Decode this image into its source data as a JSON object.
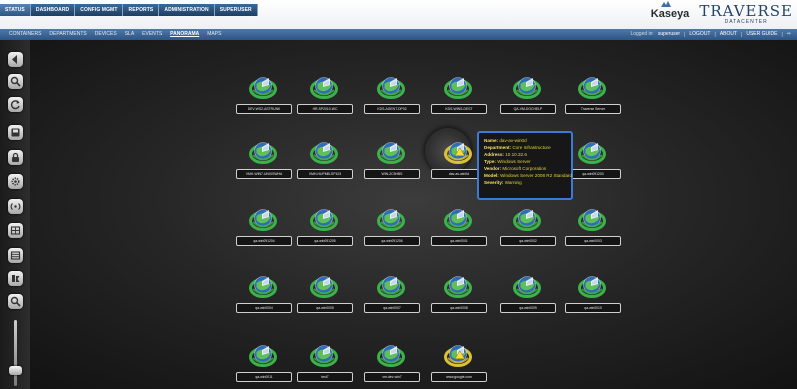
{
  "header": {
    "tabs": [
      {
        "label": "STATUS",
        "active": true
      },
      {
        "label": "DASHBOARD",
        "active": false
      },
      {
        "label": "CONFIG MGMT",
        "active": false
      },
      {
        "label": "REPORTS",
        "active": false
      },
      {
        "label": "ADMINISTRATION",
        "active": false
      },
      {
        "label": "SUPERUSER",
        "active": false
      }
    ],
    "logo_kaseya": "Kaseya",
    "logo_traverse": "TRAVERSE",
    "logo_traverse_sub": "DATACENTER"
  },
  "subnav": {
    "items": [
      "CONTAINERS",
      "DEPARTMENTS",
      "DEVICES",
      "SLA",
      "EVENTS",
      "PANORAMA",
      "MAPS"
    ],
    "current": "PANORAMA",
    "logged_in_label": "Logged in:",
    "username": "superuser",
    "logout": "LOGOUT",
    "about": "ABOUT",
    "user_guide": "USER GUIDE"
  },
  "toolbar": {
    "icons": [
      "back-icon",
      "search-icon",
      "refresh-icon",
      "save-icon",
      "lock-icon",
      "settings-icon",
      "radio-icon",
      "layout-icon",
      "grid-icon",
      "filter-icon",
      "zoom-icon"
    ]
  },
  "devices": [
    {
      "name": "DEV-WS2-ASTRUNK",
      "status": "ok"
    },
    {
      "name": "HR-SP2010-WC",
      "status": "ok"
    },
    {
      "name": "KDS-AGENT-DP02",
      "status": "ok"
    },
    {
      "name": "KDS-WINS-DEST",
      "status": "ok"
    },
    {
      "name": "QA-VM-DOCHELP",
      "status": "ok"
    },
    {
      "name": "Traverse Server",
      "status": "ok"
    },
    {
      "name": "VMH-WIN7-UNIXSWHA",
      "status": "ok"
    },
    {
      "name": "VMH-HUPMB-SP103",
      "status": "ok"
    },
    {
      "name": "WIN-2C5HBS",
      "status": "ok"
    },
    {
      "name": "dav-av-win0d",
      "status": "warning"
    },
    {
      "name": "qa-win0010",
      "status": "ok"
    },
    {
      "name": "qa-win091203",
      "status": "ok"
    },
    {
      "name": "qa-win091204",
      "status": "ok"
    },
    {
      "name": "qa-win091205",
      "status": "ok"
    },
    {
      "name": "qa-win091206",
      "status": "ok"
    },
    {
      "name": "qa-win0001",
      "status": "ok"
    },
    {
      "name": "qa-win0002",
      "status": "ok"
    },
    {
      "name": "qa-win0003",
      "status": "ok"
    },
    {
      "name": "qa-win0004",
      "status": "ok"
    },
    {
      "name": "qa-win0005",
      "status": "ok"
    },
    {
      "name": "qa-win0007",
      "status": "ok"
    },
    {
      "name": "qa-win0008",
      "status": "ok"
    },
    {
      "name": "qa-win0009",
      "status": "ok"
    },
    {
      "name": "qa-win0010",
      "status": "ok"
    },
    {
      "name": "qa-win0011",
      "status": "ok"
    },
    {
      "name": "test7",
      "status": "ok"
    },
    {
      "name": "vm-dev-win7",
      "status": "ok"
    },
    {
      "name": "www.google.com",
      "status": "warning"
    }
  ],
  "tooltip": {
    "rows": [
      {
        "key": "Name:",
        "value": "dav-av-win0d"
      },
      {
        "key": "Department:",
        "value": "Core Infrastructure"
      },
      {
        "key": "Address:",
        "value": "10.10.32.6"
      },
      {
        "key": "Type:",
        "value": "Windows Server"
      },
      {
        "key": "Vendor:",
        "value": "Microsoft Corporation"
      },
      {
        "key": "Model:",
        "value": "Windows Server 2008 R2 Standard"
      },
      {
        "key": "Severity:",
        "value": "Warning"
      }
    ]
  },
  "colors": {
    "ok_ring": "#3bb34a",
    "warning_ring": "#d9c235",
    "tooltip_border": "#3c7ad8",
    "tooltip_text": "#f4e06a"
  }
}
